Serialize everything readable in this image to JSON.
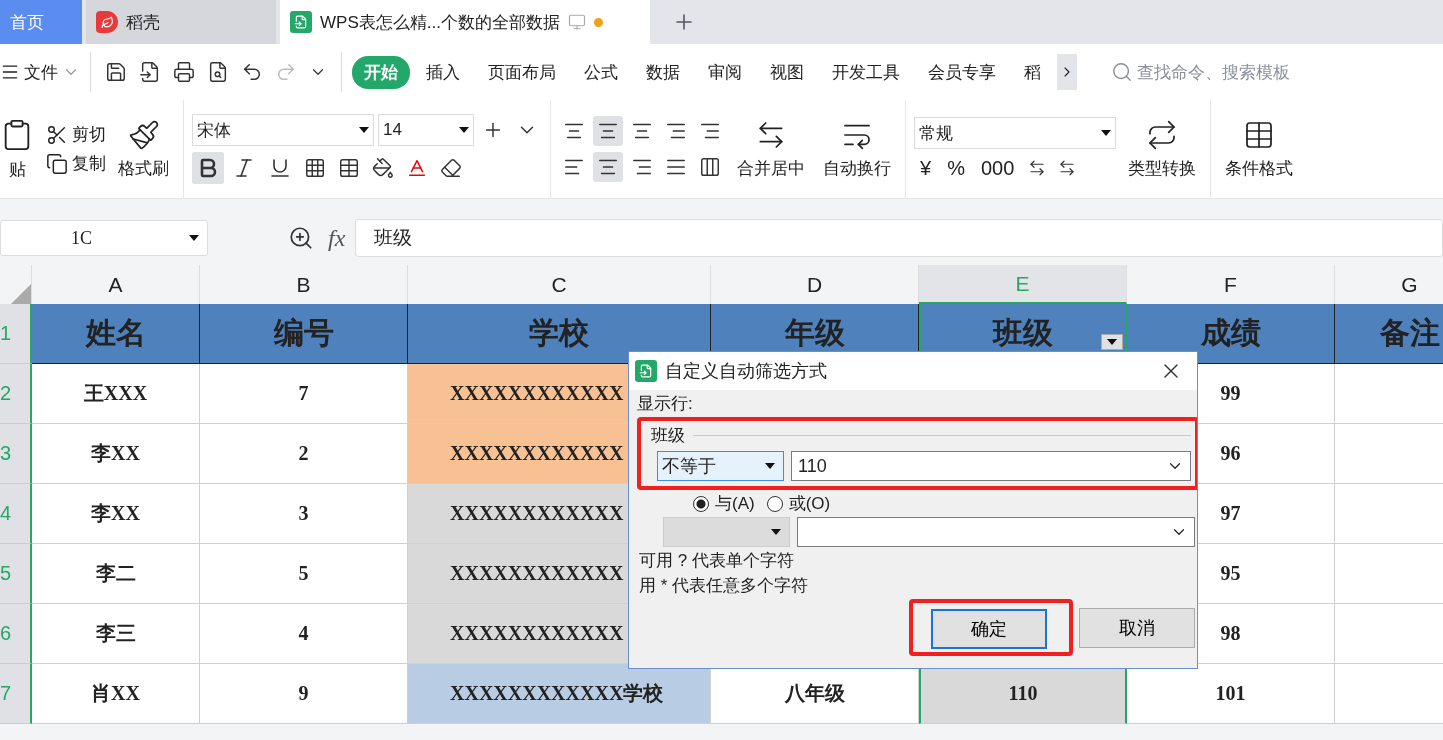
{
  "tabs": [
    {
      "kind": "home",
      "label": "首页",
      "selected": false
    },
    {
      "kind": "docer",
      "label": "稻壳",
      "selected": false
    },
    {
      "kind": "sheet",
      "label": "WPS表怎么精...个数的全部数据",
      "selected": true,
      "modified": true
    }
  ],
  "menu": {
    "file": "文件",
    "ribbon_tabs": [
      {
        "label": "开始",
        "selected": true
      },
      {
        "label": "插入",
        "selected": false
      },
      {
        "label": "页面布局",
        "selected": false
      },
      {
        "label": "公式",
        "selected": false
      },
      {
        "label": "数据",
        "selected": false
      },
      {
        "label": "审阅",
        "selected": false
      },
      {
        "label": "视图",
        "selected": false
      },
      {
        "label": "开发工具",
        "selected": false
      },
      {
        "label": "会员专享",
        "selected": false
      },
      {
        "label": "稻",
        "selected": false
      }
    ],
    "search": {
      "placeholder": "查找命令、搜索模板"
    }
  },
  "ribbon": {
    "paste": "贴",
    "cut": "剪切",
    "copy": "复制",
    "format_painter": "格式刷",
    "font": "宋体",
    "size": "14",
    "font_styles": [
      {
        "kind": "bold",
        "selected": true
      },
      {
        "kind": "italic",
        "selected": false
      },
      {
        "kind": "underline",
        "selected": false
      }
    ],
    "alignment": [
      {
        "kind": "top",
        "selected": false
      },
      {
        "kind": "middle",
        "selected": true
      },
      {
        "kind": "bottom",
        "selected": false
      },
      {
        "kind": "outdent",
        "selected": false
      },
      {
        "kind": "indent",
        "selected": false
      },
      {
        "kind": "left",
        "selected": false
      },
      {
        "kind": "center",
        "selected": true
      },
      {
        "kind": "right",
        "selected": false
      },
      {
        "kind": "justify",
        "selected": false
      },
      {
        "kind": "distributed",
        "selected": false
      }
    ],
    "merge": "合并居中",
    "wrap": "自动换行",
    "number_format": "常规",
    "currency": "¥",
    "percent": "%",
    "thousands": "000",
    "convert": "类型转换",
    "conditional": "条件格式"
  },
  "formula_bar": {
    "name_box": "1C",
    "fx": "fx",
    "value": "班级"
  },
  "sheet": {
    "columns": [
      {
        "label": "A",
        "selected": false
      },
      {
        "label": "B",
        "selected": false
      },
      {
        "label": "C",
        "selected": false
      },
      {
        "label": "D",
        "selected": false
      },
      {
        "label": "E",
        "selected": true
      },
      {
        "label": "F",
        "selected": false
      },
      {
        "label": "G",
        "selected": false
      }
    ],
    "rows": [
      {
        "number": "1",
        "cells": [
          {
            "text": "姓名",
            "color": "#4f81bd"
          },
          {
            "text": "编号",
            "color": "#4f81bd"
          },
          {
            "text": "学校",
            "color": "#4f81bd"
          },
          {
            "text": "年级",
            "color": "#4f81bd"
          },
          {
            "text": "班级",
            "color": "#4f81bd",
            "filter": true
          },
          {
            "text": "成绩",
            "color": "#4f81bd"
          },
          {
            "text": "备注",
            "color": "#4f81bd"
          }
        ]
      },
      {
        "number": "2",
        "cells": [
          {
            "text": "王XXX"
          },
          {
            "text": "7"
          },
          {
            "text": "XXXXXXXXXXXX",
            "color": "#f8c193"
          },
          {},
          {},
          {
            "text": "99"
          },
          {}
        ]
      },
      {
        "number": "3",
        "cells": [
          {
            "text": "李XX"
          },
          {
            "text": "2"
          },
          {
            "text": "XXXXXXXXXXXX",
            "color": "#f8c193"
          },
          {},
          {},
          {
            "text": "96"
          },
          {}
        ]
      },
      {
        "number": "4",
        "cells": [
          {
            "text": "李XX"
          },
          {
            "text": "3"
          },
          {
            "text": "XXXXXXXXXXXX",
            "color": "#d9d9d9"
          },
          {},
          {},
          {
            "text": "97"
          },
          {}
        ]
      },
      {
        "number": "5",
        "cells": [
          {
            "text": "李二"
          },
          {
            "text": "5"
          },
          {
            "text": "XXXXXXXXXXXX",
            "color": "#d9d9d9"
          },
          {},
          {},
          {
            "text": "95"
          },
          {}
        ]
      },
      {
        "number": "6",
        "cells": [
          {
            "text": "李三"
          },
          {
            "text": "4"
          },
          {
            "text": "XXXXXXXXXXXX",
            "color": "#d9d9d9"
          },
          {},
          {},
          {
            "text": "98"
          },
          {}
        ]
      },
      {
        "number": "7",
        "cells": [
          {
            "text": "肖XX"
          },
          {
            "text": "9"
          },
          {
            "text": "XXXXXXXXXXXX学校",
            "color": "#b8cce4"
          },
          {
            "text": "八年级"
          },
          {
            "text": "110",
            "color": "#d9d9d9"
          },
          {
            "text": "101"
          },
          {}
        ]
      }
    ]
  },
  "dialog": {
    "title": "自定义自动筛选方式",
    "section_label": "显示行:",
    "field": "班级",
    "condition1": {
      "operator": "不等于",
      "value": "110"
    },
    "join": [
      {
        "label": "与(A)",
        "selected": true
      },
      {
        "label": "或(O)",
        "selected": false
      }
    ],
    "condition2": {
      "disabled": true
    },
    "hints": [
      "可用 ? 代表单个字符",
      "用 * 代表任意多个字符"
    ],
    "buttons": [
      {
        "label": "确定",
        "default": true
      },
      {
        "label": "取消",
        "default": false
      }
    ]
  }
}
